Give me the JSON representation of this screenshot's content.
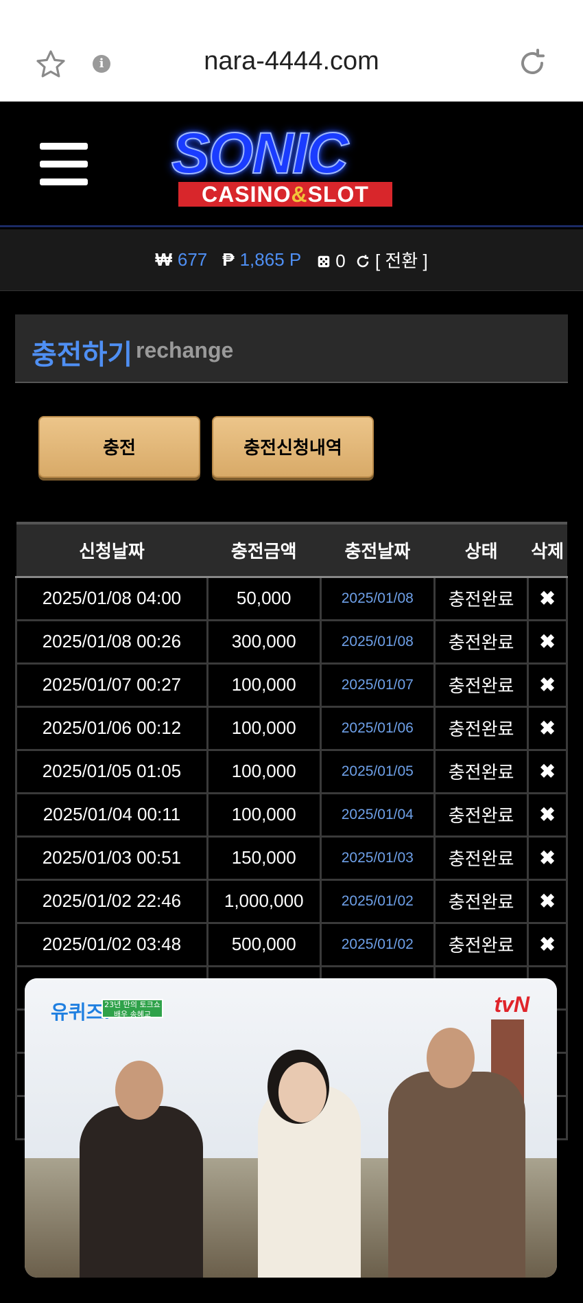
{
  "browser": {
    "url": "nara-4444.com"
  },
  "balance": {
    "won_symbol": "₩",
    "won_value": "677",
    "point_symbol": "₱",
    "point_value": "1,865 P",
    "chip_value": "0",
    "switch_label": "[ 전환 ]"
  },
  "logo": {
    "main": "SONIC",
    "sub_left": "CASINO",
    "sub_amp": "&",
    "sub_right": "SLOT"
  },
  "section": {
    "title_kr": "충전하기",
    "title_en": "rechange"
  },
  "buttons": {
    "charge": "충전",
    "history": "충전신청내역"
  },
  "table": {
    "headers": [
      "신청날짜",
      "충전금액",
      "충전날짜",
      "상태",
      "삭제"
    ],
    "rows": [
      {
        "request_date": "2025/01/08 04:00",
        "amount": "50,000",
        "charge_date": "2025/01/08",
        "status": "충전완료",
        "delete": "✖"
      },
      {
        "request_date": "2025/01/08 00:26",
        "amount": "300,000",
        "charge_date": "2025/01/08",
        "status": "충전완료",
        "delete": "✖"
      },
      {
        "request_date": "2025/01/07 00:27",
        "amount": "100,000",
        "charge_date": "2025/01/07",
        "status": "충전완료",
        "delete": "✖"
      },
      {
        "request_date": "2025/01/06 00:12",
        "amount": "100,000",
        "charge_date": "2025/01/06",
        "status": "충전완료",
        "delete": "✖"
      },
      {
        "request_date": "2025/01/05 01:05",
        "amount": "100,000",
        "charge_date": "2025/01/05",
        "status": "충전완료",
        "delete": "✖"
      },
      {
        "request_date": "2025/01/04 00:11",
        "amount": "100,000",
        "charge_date": "2025/01/04",
        "status": "충전완료",
        "delete": "✖"
      },
      {
        "request_date": "2025/01/03 00:51",
        "amount": "150,000",
        "charge_date": "2025/01/03",
        "status": "충전완료",
        "delete": "✖"
      },
      {
        "request_date": "2025/01/02 22:46",
        "amount": "1,000,000",
        "charge_date": "2025/01/02",
        "status": "충전완료",
        "delete": "✖"
      },
      {
        "request_date": "2025/01/02 03:48",
        "amount": "500,000",
        "charge_date": "2025/01/02",
        "status": "충전완료",
        "delete": "✖"
      }
    ]
  },
  "video": {
    "channel": "tvN",
    "show": "유퀴즈!",
    "caption": "23년 만의 토크쇼 배우 송혜교"
  }
}
